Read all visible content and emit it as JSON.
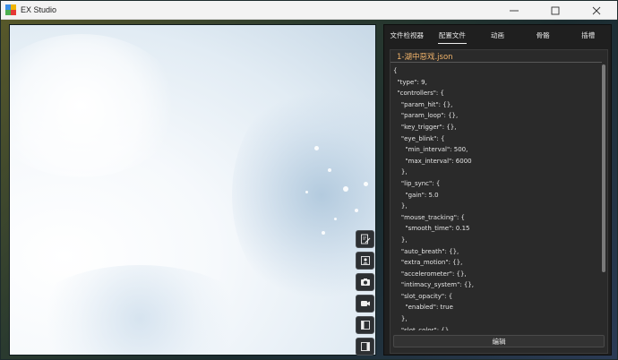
{
  "window": {
    "title": "EX Studio"
  },
  "titlebar": {
    "controls": [
      "minimize-icon",
      "maximize-icon",
      "close-icon"
    ]
  },
  "tabs": [
    {
      "label": "文件检视器",
      "active": false
    },
    {
      "label": "配置文件",
      "active": true
    },
    {
      "label": "动画",
      "active": false
    },
    {
      "label": "骨骼",
      "active": false
    },
    {
      "label": "插槽",
      "active": false
    }
  ],
  "editor": {
    "file_name": "1-湖中惡戏.json",
    "lines": [
      "{",
      "  \"type\": 9,",
      "  \"controllers\": {",
      "    \"param_hit\": {},",
      "    \"param_loop\": {},",
      "    \"key_trigger\": {},",
      "    \"eye_blink\": {",
      "      \"min_interval\": 500,",
      "      \"max_interval\": 6000",
      "    },",
      "    \"lip_sync\": {",
      "      \"gain\": 5.0",
      "    },",
      "    \"mouse_tracking\": {",
      "      \"smooth_time\": 0.15",
      "    },",
      "    \"auto_breath\": {},",
      "    \"extra_motion\": {},",
      "    \"accelerometer\": {},",
      "    \"intimacy_system\": {},",
      "    \"slot_opacity\": {",
      "      \"enabled\": true",
      "    },",
      "    \"slot_color\": {}"
    ],
    "edit_label": "编辑"
  },
  "tools": [
    "edit-file-icon",
    "portrait-icon",
    "camera-icon",
    "video-camera-icon",
    "panel-left-icon",
    "panel-right-icon"
  ],
  "colors": {
    "accent_filename": "#f2b46b",
    "panel_bg": "#1f1f1f",
    "editor_bg": "#2a2a2a"
  }
}
